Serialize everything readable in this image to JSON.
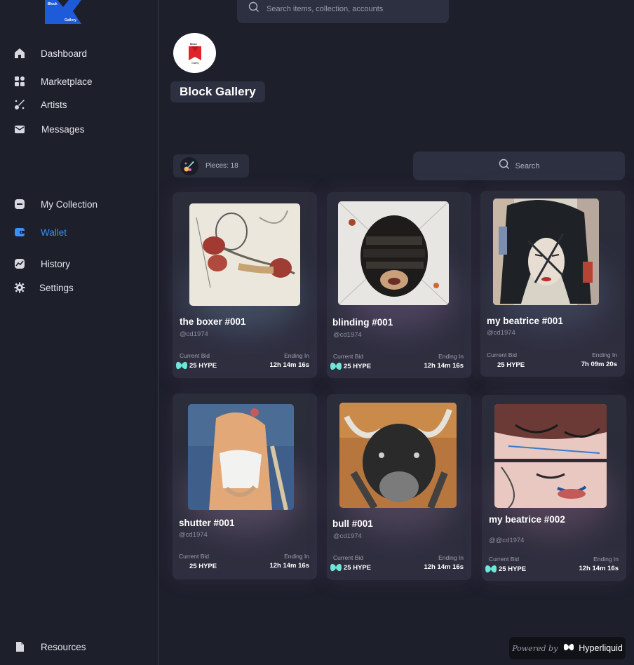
{
  "logo": {
    "line1": "Block",
    "line2": "Gallery"
  },
  "sidebar": {
    "items": [
      {
        "label": "Dashboard",
        "icon": "home-icon"
      },
      {
        "label": "Marketplace",
        "icon": "grid-icon"
      },
      {
        "label": "Artists",
        "icon": "brush-icon"
      },
      {
        "label": "Messages",
        "icon": "mail-icon"
      },
      {
        "label": "My Collection",
        "icon": "collection-icon"
      },
      {
        "label": "Wallet",
        "icon": "wallet-icon"
      },
      {
        "label": "History",
        "icon": "chart-icon"
      },
      {
        "label": "Settings",
        "icon": "gear-icon"
      },
      {
        "label": "Resources",
        "icon": "document-icon"
      }
    ],
    "active_color": "#3b8ff5"
  },
  "header": {
    "search_placeholder": "Search items, collection, accounts"
  },
  "profile": {
    "title": "Block Gallery"
  },
  "toolbar": {
    "pieces_label": "Pieces: 18",
    "search_placeholder": "Search"
  },
  "cards": [
    {
      "name": "the boxer #001",
      "handle": "@cd1974",
      "bid_label": "Current Bid",
      "bid": "25 HYPE",
      "end_label": "Ending In",
      "end": "12h 14m 16s"
    },
    {
      "name": "blinding #001",
      "handle": "@cd1974",
      "bid_label": "Current Bid",
      "bid": "25 HYPE",
      "end_label": "Ending In",
      "end": "12h 14m 16s"
    },
    {
      "name": "my beatrice #001",
      "handle": "@cd1974",
      "bid_label": "Current Bid",
      "bid": "25 HYPE",
      "end_label": "Ending In",
      "end": "7h 09m 20s"
    },
    {
      "name": "shutter #001",
      "handle": "@cd1974",
      "bid_label": "Current Bid",
      "bid": "25 HYPE",
      "end_label": "Ending In",
      "end": "12h 14m 16s"
    },
    {
      "name": "bull #001",
      "handle": "@cd1974",
      "bid_label": "Current Bid",
      "bid": "25 HYPE",
      "end_label": "Ending In",
      "end": "12h 14m 16s"
    },
    {
      "name": "my beatrice #002",
      "handle": "@@cd1974",
      "bid_label": "Current Bid",
      "bid": "25 HYPE",
      "end_label": "Ending In",
      "end": "12h 14m 16s"
    }
  ],
  "footer": {
    "powered_by": "Powered by",
    "brand": "Hyperliquid"
  },
  "colors": {
    "accent": "#3b8ff5",
    "hype": "#6ee7d9",
    "background": "#1d1f2b"
  }
}
